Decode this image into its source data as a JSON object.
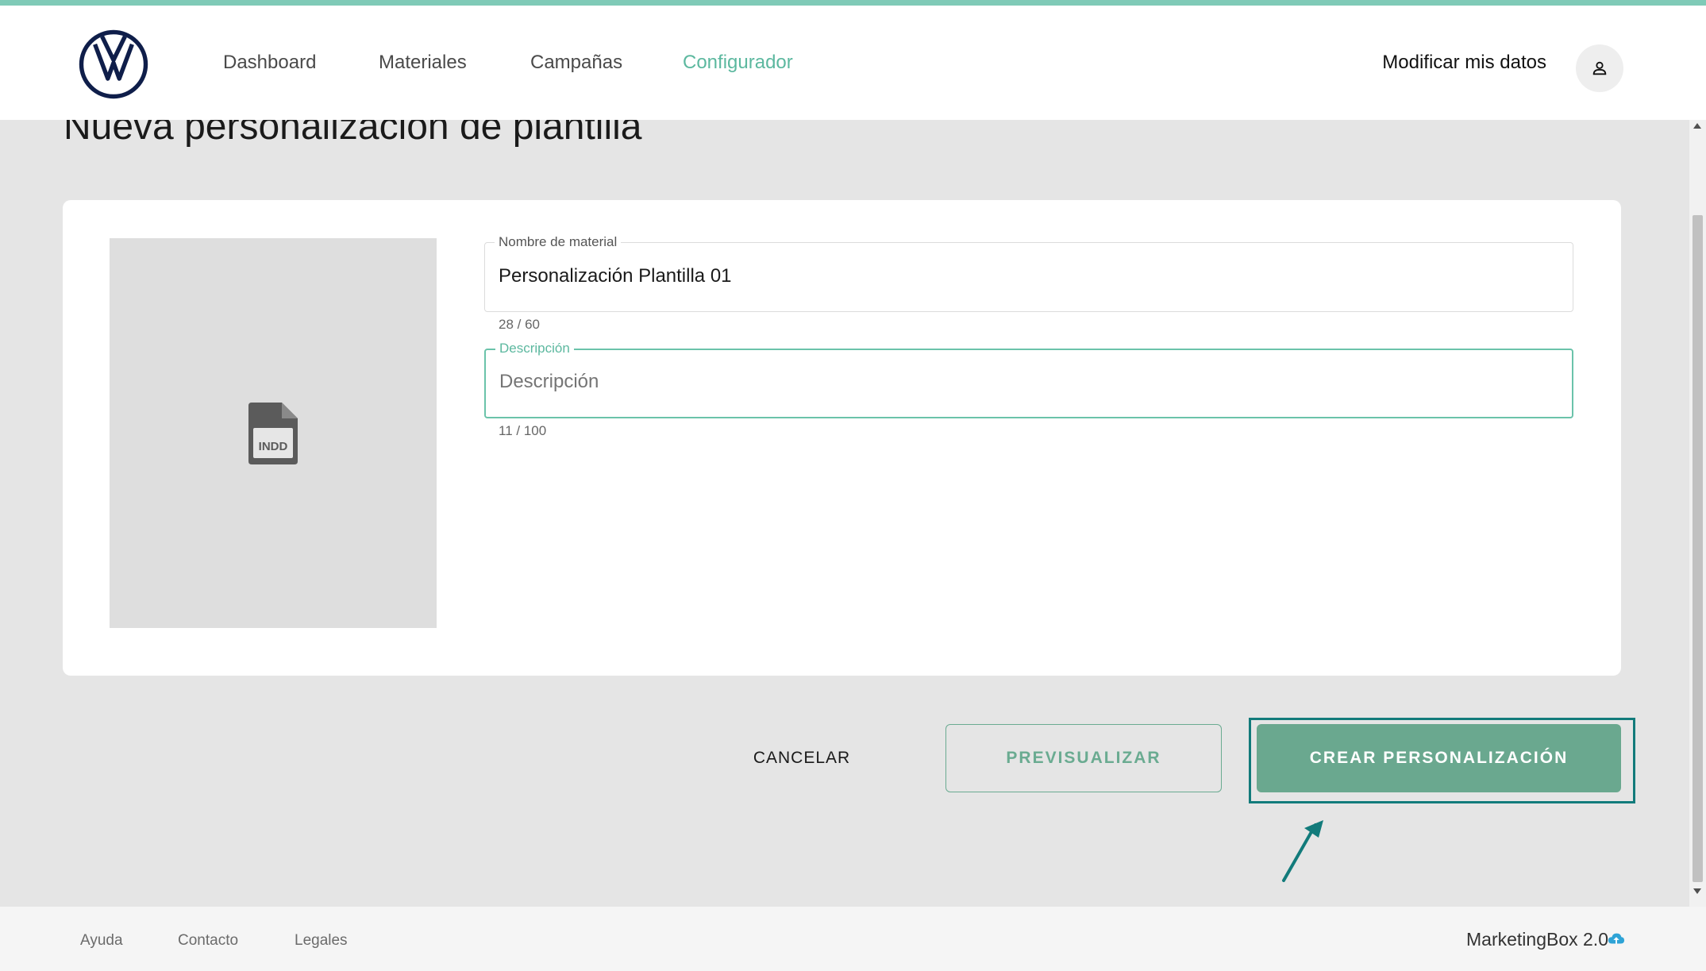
{
  "header": {
    "nav": [
      {
        "label": "Dashboard",
        "active": false
      },
      {
        "label": "Materiales",
        "active": false
      },
      {
        "label": "Campañas",
        "active": false
      },
      {
        "label": "Configurador",
        "active": true
      }
    ],
    "account_label": "Modificar mis datos",
    "logo_icon": "vw-logo-icon",
    "avatar_icon": "user-icon"
  },
  "page": {
    "title": "Nueva personalización de plantilla"
  },
  "form": {
    "thumbnail": {
      "icon": "indd-file-icon",
      "text": "INDD"
    },
    "name_field": {
      "label": "Nombre de material",
      "value": "Personalización Plantilla 01",
      "counter": "28 / 60"
    },
    "description_field": {
      "label": "Descripción",
      "placeholder": "Descripción",
      "value": "",
      "counter": "11 / 100",
      "focused": true
    }
  },
  "actions": {
    "cancel": "CANCELAR",
    "preview": "PREVISUALIZAR",
    "create": "CREAR PERSONALIZACIÓN"
  },
  "footer": {
    "links": [
      "Ayuda",
      "Contacto",
      "Legales"
    ],
    "brand": "MarketingBox 2.0"
  },
  "colors": {
    "accent": "#5cb89f",
    "primary_button": "#6aa88f",
    "highlight": "#127b7b",
    "top_bar": "#7fcab7"
  }
}
